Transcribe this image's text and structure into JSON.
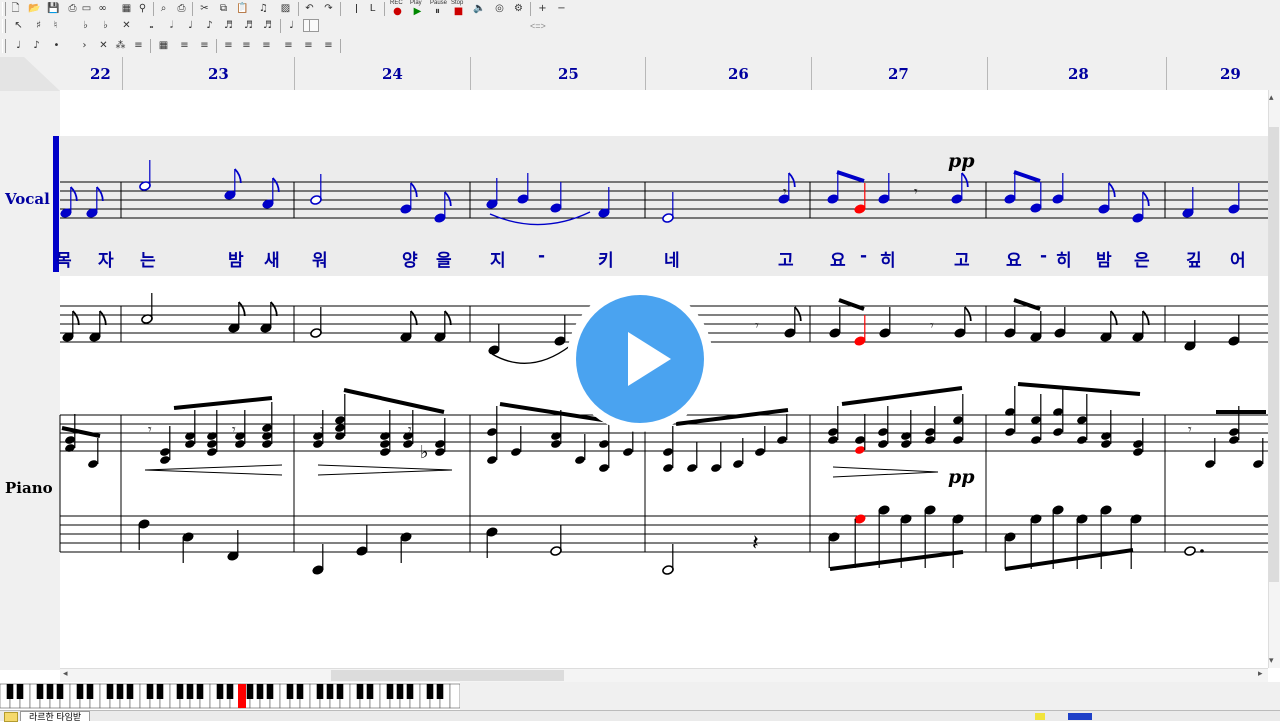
{
  "toolbar": {
    "play_label": "Play",
    "pause_label": "Pause",
    "stop_label": "Stop",
    "rec_label": "REC",
    "spacing_labels": "<=>"
  },
  "measures": [
    "22",
    "23",
    "24",
    "25",
    "26",
    "27",
    "28",
    "29"
  ],
  "staves": {
    "vocal_label": "Vocal",
    "piano_label": "Piano"
  },
  "lyrics": [
    "목",
    "자",
    "는",
    "밤",
    "새",
    "워",
    "양",
    "을",
    "지",
    "-",
    "키",
    "네",
    "고",
    "요",
    "-",
    "히",
    "고",
    "요",
    "-",
    "히",
    "밤",
    "은",
    "깊",
    "어"
  ],
  "dynamics": {
    "vocal_m27": "pp",
    "piano_m27": "pp"
  },
  "status": {
    "tab_label": "라르한 타임받"
  },
  "colors": {
    "vocal_notes": "#0000c8",
    "current_note": "#ff0000",
    "measure_numbers": "#0000a0",
    "play_button": "#4aa3f0"
  }
}
